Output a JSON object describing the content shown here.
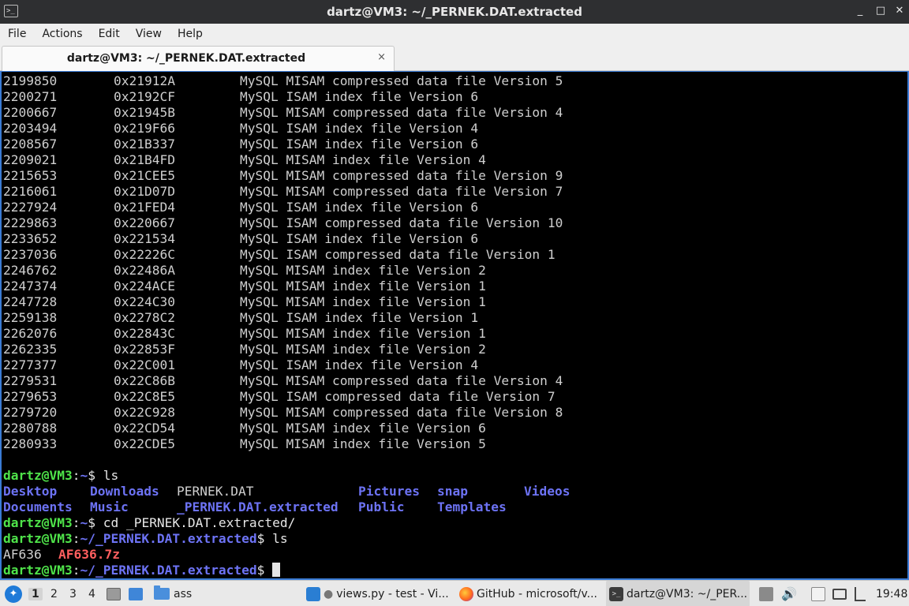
{
  "window": {
    "title": "dartz@VM3: ~/_PERNEK.DAT.extracted",
    "buttons": [
      "_",
      "□",
      "✕"
    ]
  },
  "menubar": {
    "items": [
      "File",
      "Actions",
      "Edit",
      "View",
      "Help"
    ]
  },
  "tabs": [
    {
      "label": "dartz@VM3: ~/_PERNEK.DAT.extracted",
      "close": "×"
    }
  ],
  "terminal": {
    "scan_rows": [
      {
        "dec": "2199850",
        "hex": "0x21912A",
        "desc": "MySQL MISAM compressed data file Version 5"
      },
      {
        "dec": "2200271",
        "hex": "0x2192CF",
        "desc": "MySQL ISAM index file Version 6"
      },
      {
        "dec": "2200667",
        "hex": "0x21945B",
        "desc": "MySQL MISAM compressed data file Version 4"
      },
      {
        "dec": "2203494",
        "hex": "0x219F66",
        "desc": "MySQL ISAM index file Version 4"
      },
      {
        "dec": "2208567",
        "hex": "0x21B337",
        "desc": "MySQL ISAM index file Version 6"
      },
      {
        "dec": "2209021",
        "hex": "0x21B4FD",
        "desc": "MySQL MISAM index file Version 4"
      },
      {
        "dec": "2215653",
        "hex": "0x21CEE5",
        "desc": "MySQL MISAM compressed data file Version 9"
      },
      {
        "dec": "2216061",
        "hex": "0x21D07D",
        "desc": "MySQL MISAM compressed data file Version 7"
      },
      {
        "dec": "2227924",
        "hex": "0x21FED4",
        "desc": "MySQL ISAM index file Version 6"
      },
      {
        "dec": "2229863",
        "hex": "0x220667",
        "desc": "MySQL ISAM compressed data file Version 10"
      },
      {
        "dec": "2233652",
        "hex": "0x221534",
        "desc": "MySQL ISAM index file Version 6"
      },
      {
        "dec": "2237036",
        "hex": "0x22226C",
        "desc": "MySQL ISAM compressed data file Version 1"
      },
      {
        "dec": "2246762",
        "hex": "0x22486A",
        "desc": "MySQL MISAM index file Version 2"
      },
      {
        "dec": "2247374",
        "hex": "0x224ACE",
        "desc": "MySQL MISAM index file Version 1"
      },
      {
        "dec": "2247728",
        "hex": "0x224C30",
        "desc": "MySQL MISAM index file Version 1"
      },
      {
        "dec": "2259138",
        "hex": "0x2278C2",
        "desc": "MySQL ISAM index file Version 1"
      },
      {
        "dec": "2262076",
        "hex": "0x22843C",
        "desc": "MySQL MISAM index file Version 1"
      },
      {
        "dec": "2262335",
        "hex": "0x22853F",
        "desc": "MySQL MISAM index file Version 2"
      },
      {
        "dec": "2277377",
        "hex": "0x22C001",
        "desc": "MySQL ISAM index file Version 4"
      },
      {
        "dec": "2279531",
        "hex": "0x22C86B",
        "desc": "MySQL MISAM compressed data file Version 4"
      },
      {
        "dec": "2279653",
        "hex": "0x22C8E5",
        "desc": "MySQL ISAM compressed data file Version 7"
      },
      {
        "dec": "2279720",
        "hex": "0x22C928",
        "desc": "MySQL MISAM compressed data file Version 8"
      },
      {
        "dec": "2280788",
        "hex": "0x22CD54",
        "desc": "MySQL MISAM index file Version 6"
      },
      {
        "dec": "2280933",
        "hex": "0x22CDE5",
        "desc": "MySQL MISAM index file Version 5"
      }
    ],
    "prompt_user": "dartz@VM3",
    "commands": [
      {
        "path": "~",
        "cmd": " ls"
      },
      {
        "path": "~",
        "cmd": " cd _PERNEK.DAT.extracted/"
      },
      {
        "path": "~/_PERNEK.DAT.extracted",
        "cmd": " ls"
      },
      {
        "path": "~/_PERNEK.DAT.extracted",
        "cmd": " "
      }
    ],
    "home_listing": {
      "row1": [
        {
          "name": "Desktop",
          "kind": "dir"
        },
        {
          "name": "Downloads",
          "kind": "dir"
        },
        {
          "name": "PERNEK.DAT",
          "kind": "file"
        },
        {
          "name": "Pictures",
          "kind": "dir"
        },
        {
          "name": "snap",
          "kind": "dir"
        },
        {
          "name": "Videos",
          "kind": "dir"
        }
      ],
      "row2": [
        {
          "name": "Documents",
          "kind": "dir"
        },
        {
          "name": "Music",
          "kind": "dir"
        },
        {
          "name": "_PERNEK.DAT.extracted",
          "kind": "dir"
        },
        {
          "name": "Public",
          "kind": "dir"
        },
        {
          "name": "Templates",
          "kind": "dir"
        }
      ]
    },
    "extracted_listing": [
      {
        "name": "AF636",
        "kind": "file"
      },
      {
        "name": "AF636.7z",
        "kind": "archive"
      }
    ]
  },
  "taskbar": {
    "workspaces": [
      "1",
      "2",
      "3",
      "4"
    ],
    "active_workspace": "1",
    "launcher_folder_label": "ass",
    "tasks": [
      {
        "label": "views.py - test - Vi...",
        "icon": "vscode-icon"
      },
      {
        "label": "GitHub - microsoft/v...",
        "icon": "firefox-icon"
      },
      {
        "label": "dartz@VM3: ~/_PER...",
        "icon": "terminal-icon"
      }
    ],
    "clock": "19:48"
  },
  "colors": {
    "prompt_user": "#4fe44a",
    "prompt_path": "#6d73f5",
    "directory": "#6d73f5",
    "archive": "#ff5f5f",
    "terminal_bg": "#000000",
    "focus_border": "#3a7bd5"
  }
}
